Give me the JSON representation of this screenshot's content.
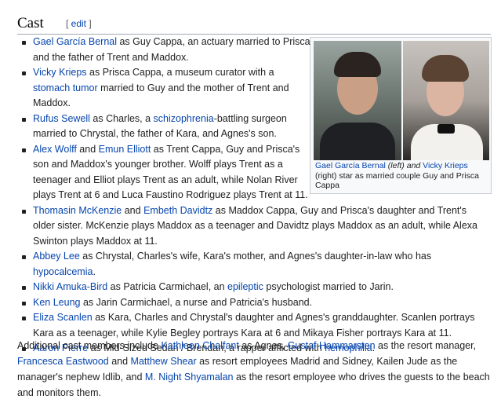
{
  "section": {
    "title": "Cast",
    "edit_open": "[ ",
    "edit_label": "edit",
    "edit_close": " ]"
  },
  "figure": {
    "caption": {
      "l1": "Gael García Bernal",
      "t1": " (left) and ",
      "l2": "Vicky Krieps",
      "t2": " (right) star as married couple Guy and Prisca Cappa"
    }
  },
  "cast": [
    {
      "a": "Gael García Bernal",
      "b": " as Guy Cappa, an actuary married to Prisca and the father of Trent and Maddox."
    },
    {
      "a": "Vicky Krieps",
      "b": " as Prisca Cappa, a museum curator with a ",
      "c": "stomach tumor",
      "d": " married to Guy and the mother of Trent and Maddox."
    },
    {
      "a": "Rufus Sewell",
      "b": " as Charles, a ",
      "c": "schizophrenia",
      "d": "-battling surgeon married to Chrystal, the father of Kara, and Agnes's son."
    },
    {
      "a": "Alex Wolff",
      "b": " and ",
      "c": "Emun Elliott",
      "d": " as Trent Cappa, Guy and Prisca's son and Maddox's younger brother. Wolff plays Trent as a teenager and Elliot plays Trent as an adult, while Nolan River plays Trent at 6 and Luca Faustino Rodriguez plays Trent at 11."
    },
    {
      "a": "Thomasin McKenzie",
      "b": " and ",
      "c": "Embeth Davidtz",
      "d": " as Maddox Cappa, Guy and Prisca's daughter and Trent's older sister. McKenzie plays Maddox as a teenager and Davidtz plays Maddox as an adult, while Alexa Swinton plays Maddox at 11."
    },
    {
      "a": "Abbey Lee",
      "b": " as Chrystal, Charles's wife, Kara's mother, and Agnes's daughter-in-law who has ",
      "c": "hypocalcemia",
      "d": "."
    },
    {
      "a": "Nikki Amuka-Bird",
      "b": " as Patricia Carmichael, an ",
      "c": "epileptic",
      "d": " psychologist married to Jarin."
    },
    {
      "a": "Ken Leung",
      "b": " as Jarin Carmichael, a nurse and Patricia's husband."
    },
    {
      "a": "Eliza Scanlen",
      "b": " as Kara, Charles and Chrystal's daughter and Agnes's granddaughter. Scanlen portrays Kara as a teenager, while Kylie Begley portrays Kara at 6 and Mikaya Fisher portrays Kara at 11."
    },
    {
      "a": "Aaron Pierre",
      "b": " as Mid-Sized Sedan / Brendan, a rapper afflicted with ",
      "c": "hemophilia",
      "d": "."
    }
  ],
  "additional": {
    "t0": "Additional cast members include ",
    "l1": "Kathleen Chalfant",
    "t1": " as Agnes, ",
    "l2": "Gustaf Hammarsten",
    "t2": " as the resort manager, ",
    "l3": "Francesca Eastwood",
    "t3": " and ",
    "l4": "Matthew Shear",
    "t4": " as resort employees Madrid and Sidney, Kailen Jude as the manager's nephew Idlib, and ",
    "l5": "M. Night Shyamalan",
    "t5": " as the resort employee who drives the guests to the beach and monitors them."
  }
}
